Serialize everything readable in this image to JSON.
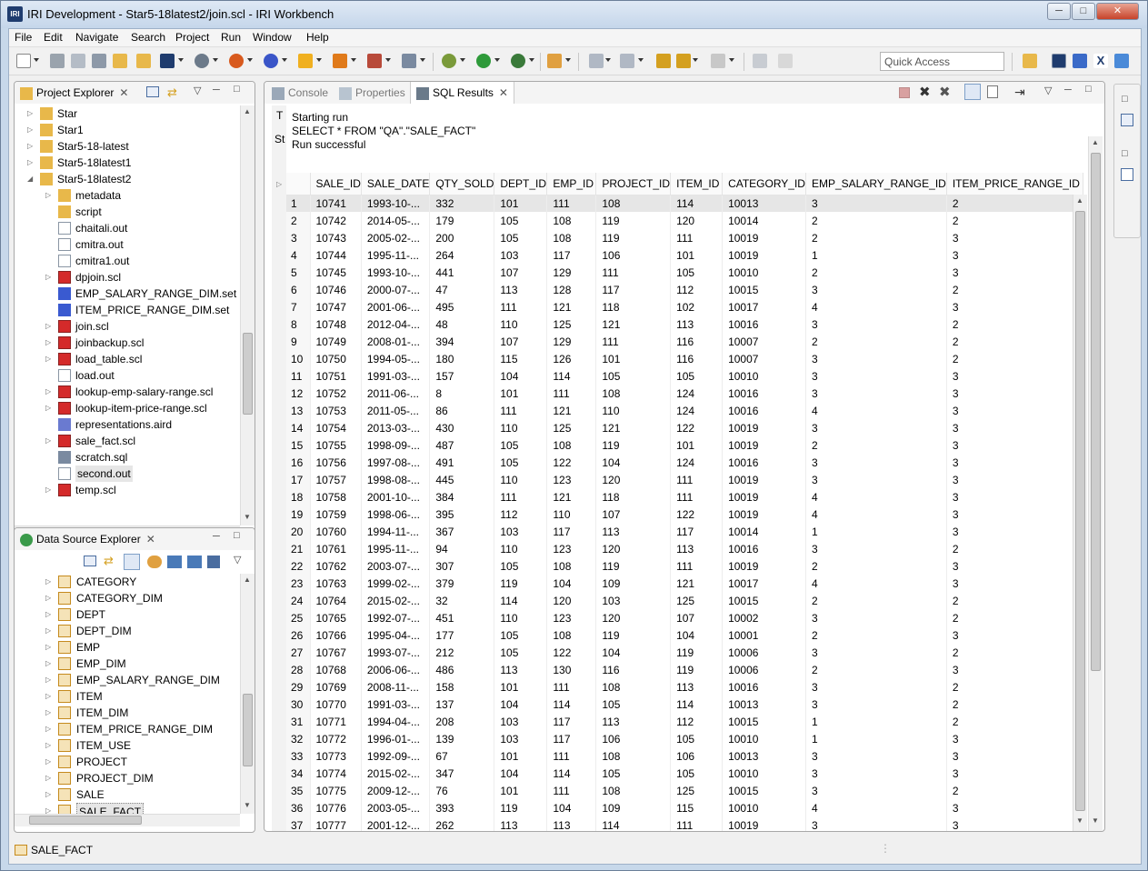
{
  "window": {
    "title": "IRI Development - Star5-18latest2/join.scl - IRI Workbench",
    "logo": "IRI"
  },
  "menu": [
    "File",
    "Edit",
    "Navigate",
    "Search",
    "Project",
    "Run",
    "Window",
    "Help"
  ],
  "toolbar": {
    "quick_access_placeholder": "Quick Access"
  },
  "project_explorer": {
    "tab": "Project Explorer",
    "items": [
      {
        "label": "Star",
        "kind": "project",
        "expanded": false
      },
      {
        "label": "Star1",
        "kind": "project",
        "expanded": false
      },
      {
        "label": "Star5-18-latest",
        "kind": "project",
        "expanded": false
      },
      {
        "label": "Star5-18latest1",
        "kind": "project",
        "expanded": false
      },
      {
        "label": "Star5-18latest2",
        "kind": "project",
        "expanded": true
      },
      {
        "label": "metadata",
        "kind": "folder",
        "expanded": false
      },
      {
        "label": "script",
        "kind": "folder-open",
        "expanded": null
      },
      {
        "label": "chaitali.out",
        "kind": "file",
        "expanded": null
      },
      {
        "label": "cmitra.out",
        "kind": "file",
        "expanded": null
      },
      {
        "label": "cmitra1.out",
        "kind": "file",
        "expanded": null
      },
      {
        "label": "dpjoin.scl",
        "kind": "scl",
        "expanded": false
      },
      {
        "label": "EMP_SALARY_RANGE_DIM.set",
        "kind": "set",
        "expanded": null
      },
      {
        "label": "ITEM_PRICE_RANGE_DIM.set",
        "kind": "set",
        "expanded": null
      },
      {
        "label": "join.scl",
        "kind": "scl",
        "expanded": false
      },
      {
        "label": "joinbackup.scl",
        "kind": "scl",
        "expanded": false
      },
      {
        "label": "load_table.scl",
        "kind": "scl",
        "expanded": false
      },
      {
        "label": "load.out",
        "kind": "file",
        "expanded": null
      },
      {
        "label": "lookup-emp-salary-range.scl",
        "kind": "scl",
        "expanded": false
      },
      {
        "label": "lookup-item-price-range.scl",
        "kind": "scl",
        "expanded": false
      },
      {
        "label": "representations.aird",
        "kind": "aird",
        "expanded": null
      },
      {
        "label": "sale_fact.scl",
        "kind": "scl",
        "expanded": false
      },
      {
        "label": "scratch.sql",
        "kind": "sql",
        "expanded": null
      },
      {
        "label": "second.out",
        "kind": "file-sel",
        "expanded": null
      },
      {
        "label": "temp.scl",
        "kind": "scl",
        "expanded": false
      }
    ]
  },
  "data_source_explorer": {
    "tab": "Data Source Explorer",
    "items": [
      "CATEGORY",
      "CATEGORY_DIM",
      "DEPT",
      "DEPT_DIM",
      "EMP",
      "EMP_DIM",
      "EMP_SALARY_RANGE_DIM",
      "ITEM",
      "ITEM_DIM",
      "ITEM_PRICE_RANGE_DIM",
      "ITEM_USE",
      "PROJECT",
      "PROJECT_DIM",
      "SALE",
      "SALE_FACT"
    ]
  },
  "results": {
    "tabs": {
      "console": "Console",
      "properties": "Properties",
      "sql_results": "SQL Results"
    },
    "side_labels": {
      "t": "T",
      "st": "St"
    },
    "log": [
      "Starting run",
      "SELECT * FROM \"QA\".\"SALE_FACT\"",
      "Run successful"
    ],
    "columns": [
      "SALE_ID",
      "SALE_DATE",
      "QTY_SOLD",
      "DEPT_ID",
      "EMP_ID",
      "PROJECT_ID",
      "ITEM_ID",
      "CATEGORY_ID",
      "EMP_SALARY_RANGE_ID",
      "ITEM_PRICE_RANGE_ID"
    ],
    "rows": [
      [
        "1",
        "10741",
        "1993-10-...",
        "332",
        "101",
        "111",
        "108",
        "114",
        "10013",
        "3",
        "2"
      ],
      [
        "2",
        "10742",
        "2014-05-...",
        "179",
        "105",
        "108",
        "119",
        "120",
        "10014",
        "2",
        "2"
      ],
      [
        "3",
        "10743",
        "2005-02-...",
        "200",
        "105",
        "108",
        "119",
        "111",
        "10019",
        "2",
        "3"
      ],
      [
        "4",
        "10744",
        "1995-11-...",
        "264",
        "103",
        "117",
        "106",
        "101",
        "10019",
        "1",
        "3"
      ],
      [
        "5",
        "10745",
        "1993-10-...",
        "441",
        "107",
        "129",
        "111",
        "105",
        "10010",
        "2",
        "3"
      ],
      [
        "6",
        "10746",
        "2000-07-...",
        "47",
        "113",
        "128",
        "117",
        "112",
        "10015",
        "3",
        "2"
      ],
      [
        "7",
        "10747",
        "2001-06-...",
        "495",
        "111",
        "121",
        "118",
        "102",
        "10017",
        "4",
        "3"
      ],
      [
        "8",
        "10748",
        "2012-04-...",
        "48",
        "110",
        "125",
        "121",
        "113",
        "10016",
        "3",
        "2"
      ],
      [
        "9",
        "10749",
        "2008-01-...",
        "394",
        "107",
        "129",
        "111",
        "116",
        "10007",
        "2",
        "2"
      ],
      [
        "10",
        "10750",
        "1994-05-...",
        "180",
        "115",
        "126",
        "101",
        "116",
        "10007",
        "3",
        "2"
      ],
      [
        "11",
        "10751",
        "1991-03-...",
        "157",
        "104",
        "114",
        "105",
        "105",
        "10010",
        "3",
        "3"
      ],
      [
        "12",
        "10752",
        "2011-06-...",
        "8",
        "101",
        "111",
        "108",
        "124",
        "10016",
        "3",
        "3"
      ],
      [
        "13",
        "10753",
        "2011-05-...",
        "86",
        "111",
        "121",
        "110",
        "124",
        "10016",
        "4",
        "3"
      ],
      [
        "14",
        "10754",
        "2013-03-...",
        "430",
        "110",
        "125",
        "121",
        "122",
        "10019",
        "3",
        "3"
      ],
      [
        "15",
        "10755",
        "1998-09-...",
        "487",
        "105",
        "108",
        "119",
        "101",
        "10019",
        "2",
        "3"
      ],
      [
        "16",
        "10756",
        "1997-08-...",
        "491",
        "105",
        "122",
        "104",
        "124",
        "10016",
        "3",
        "3"
      ],
      [
        "17",
        "10757",
        "1998-08-...",
        "445",
        "110",
        "123",
        "120",
        "111",
        "10019",
        "3",
        "3"
      ],
      [
        "18",
        "10758",
        "2001-10-...",
        "384",
        "111",
        "121",
        "118",
        "111",
        "10019",
        "4",
        "3"
      ],
      [
        "19",
        "10759",
        "1998-06-...",
        "395",
        "112",
        "110",
        "107",
        "122",
        "10019",
        "4",
        "3"
      ],
      [
        "20",
        "10760",
        "1994-11-...",
        "367",
        "103",
        "117",
        "113",
        "117",
        "10014",
        "1",
        "3"
      ],
      [
        "21",
        "10761",
        "1995-11-...",
        "94",
        "110",
        "123",
        "120",
        "113",
        "10016",
        "3",
        "2"
      ],
      [
        "22",
        "10762",
        "2003-07-...",
        "307",
        "105",
        "108",
        "119",
        "111",
        "10019",
        "2",
        "3"
      ],
      [
        "23",
        "10763",
        "1999-02-...",
        "379",
        "119",
        "104",
        "109",
        "121",
        "10017",
        "4",
        "3"
      ],
      [
        "24",
        "10764",
        "2015-02-...",
        "32",
        "114",
        "120",
        "103",
        "125",
        "10015",
        "2",
        "2"
      ],
      [
        "25",
        "10765",
        "1992-07-...",
        "451",
        "110",
        "123",
        "120",
        "107",
        "10002",
        "3",
        "2"
      ],
      [
        "26",
        "10766",
        "1995-04-...",
        "177",
        "105",
        "108",
        "119",
        "104",
        "10001",
        "2",
        "3"
      ],
      [
        "27",
        "10767",
        "1993-07-...",
        "212",
        "105",
        "122",
        "104",
        "119",
        "10006",
        "3",
        "2"
      ],
      [
        "28",
        "10768",
        "2006-06-...",
        "486",
        "113",
        "130",
        "116",
        "119",
        "10006",
        "2",
        "3"
      ],
      [
        "29",
        "10769",
        "2008-11-...",
        "158",
        "101",
        "111",
        "108",
        "113",
        "10016",
        "3",
        "2"
      ],
      [
        "30",
        "10770",
        "1991-03-...",
        "137",
        "104",
        "114",
        "105",
        "114",
        "10013",
        "3",
        "2"
      ],
      [
        "31",
        "10771",
        "1994-04-...",
        "208",
        "103",
        "117",
        "113",
        "112",
        "10015",
        "1",
        "2"
      ],
      [
        "32",
        "10772",
        "1996-01-...",
        "139",
        "103",
        "117",
        "106",
        "105",
        "10010",
        "1",
        "3"
      ],
      [
        "33",
        "10773",
        "1992-09-...",
        "67",
        "101",
        "111",
        "108",
        "106",
        "10013",
        "3",
        "3"
      ],
      [
        "34",
        "10774",
        "2015-02-...",
        "347",
        "104",
        "114",
        "105",
        "105",
        "10010",
        "3",
        "3"
      ],
      [
        "35",
        "10775",
        "2009-12-...",
        "76",
        "101",
        "111",
        "108",
        "125",
        "10015",
        "3",
        "2"
      ],
      [
        "36",
        "10776",
        "2003-05-...",
        "393",
        "119",
        "104",
        "109",
        "115",
        "10010",
        "4",
        "3"
      ],
      [
        "37",
        "10777",
        "2001-12-...",
        "262",
        "113",
        "113",
        "114",
        "111",
        "10019",
        "3",
        "3"
      ]
    ]
  },
  "status": {
    "selection": "SALE_FACT"
  },
  "colors": {
    "titlebar": "#c7d8ea",
    "close": "#c7432a",
    "selected_row": "#e6e6e6",
    "folder": "#e8b84a",
    "table_icon": "#c58a1d",
    "scl_icon": "#d42a2a"
  }
}
